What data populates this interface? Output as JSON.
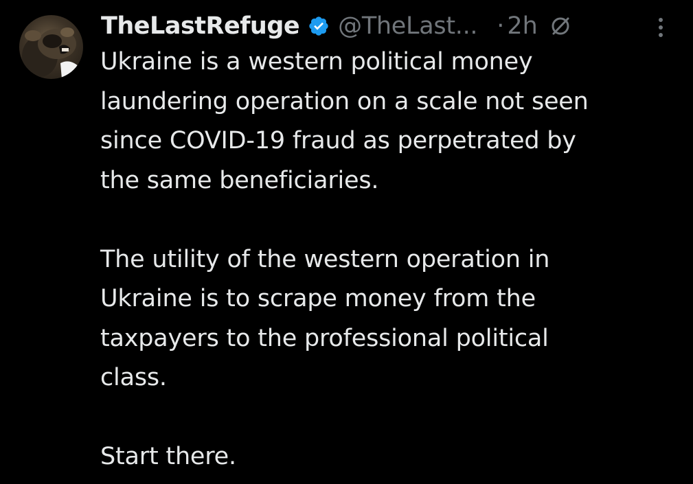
{
  "tweet": {
    "author": {
      "display_name": "TheLastRefuge",
      "handle": "@TheLast...",
      "verified": true
    },
    "separator": "·",
    "timestamp": "2h",
    "paragraphs": [
      "Ukraine is a western political money laundering operation on a scale not seen since COVID-19 fraud as perpetrated by the same beneficiaries.",
      "The utility of the western operation in Ukraine is to scrape money from the taxpayers to the professional political class.",
      "Start there."
    ],
    "lines": [
      [
        "Ukraine is a western political money",
        "laundering operation on a scale not seen",
        "since COVID-19 fraud as perpetrated by",
        "the same beneficiaries."
      ],
      [
        "The utility of the western operation in",
        "Ukraine is to scrape money from the",
        "taxpayers to the professional political",
        "class."
      ],
      [
        "Start there."
      ]
    ]
  },
  "colors": {
    "background": "#000000",
    "primary_text": "#e7e9ea",
    "secondary_text": "#71767b",
    "verified_badge": "#1d9bf0"
  },
  "icons": {
    "verified": "verified-badge-icon",
    "edited": "edit-history-icon",
    "more": "more-options-icon"
  }
}
